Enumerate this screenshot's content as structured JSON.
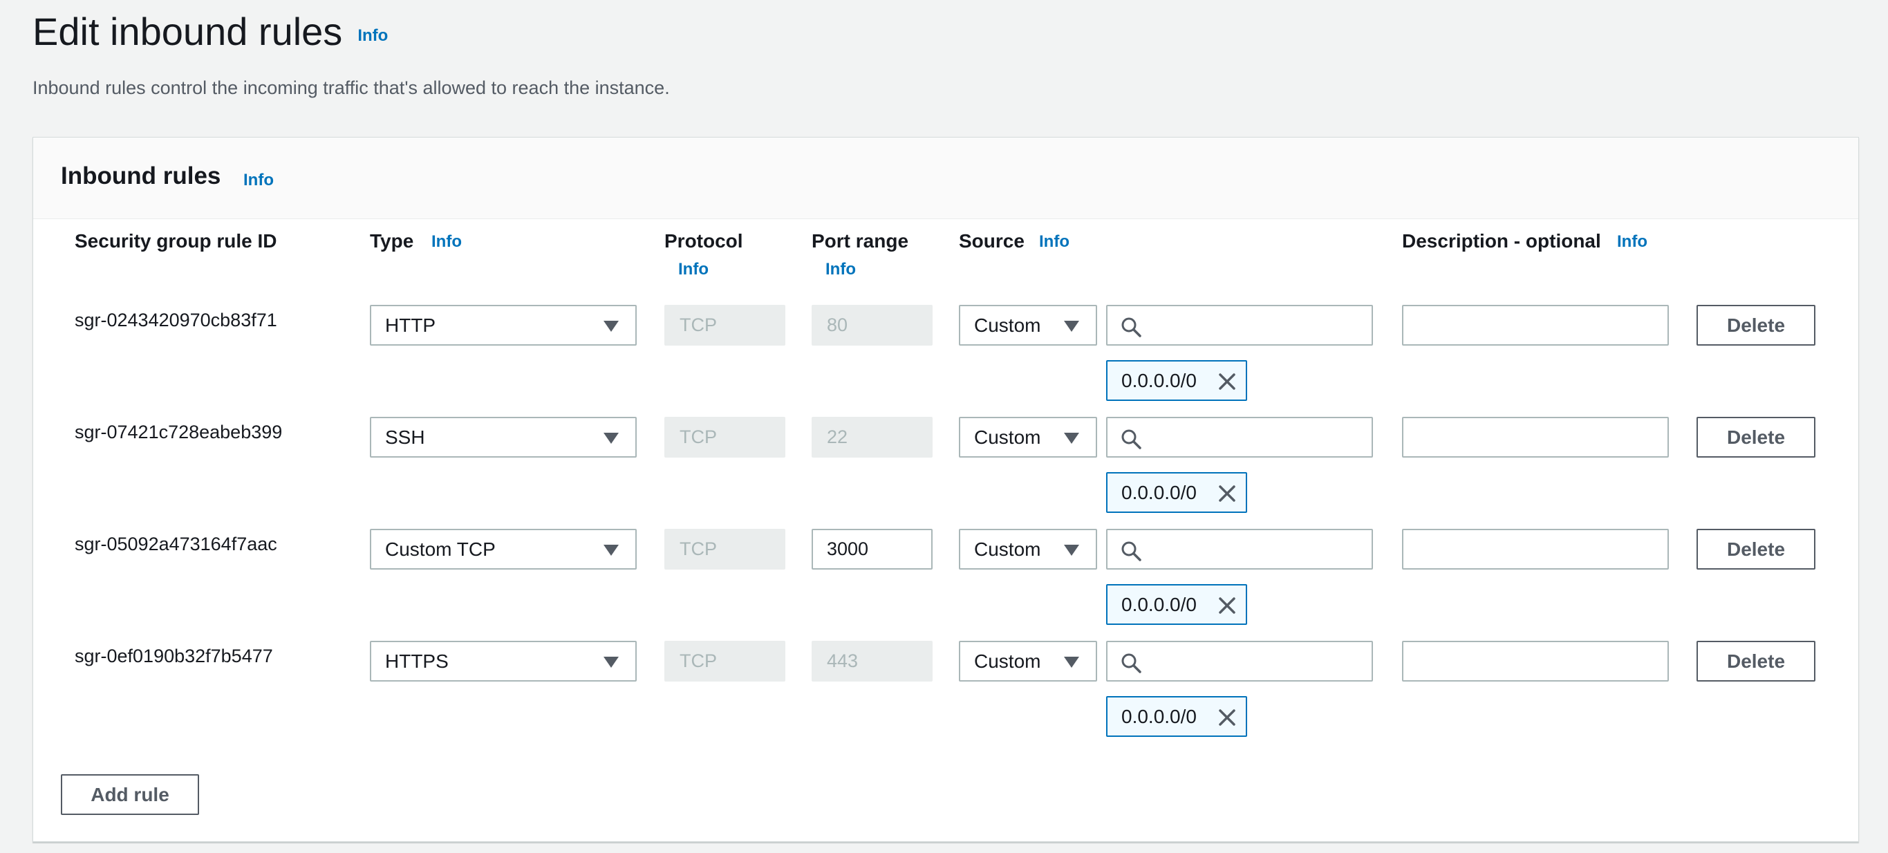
{
  "page": {
    "title": "Edit inbound rules",
    "info": "Info",
    "description": "Inbound rules control the incoming traffic that's allowed to reach the instance."
  },
  "panel": {
    "title": "Inbound rules",
    "info": "Info",
    "columns": {
      "rule_id": "Security group rule ID",
      "type": "Type",
      "protocol": "Protocol",
      "port_range": "Port range",
      "source": "Source",
      "description": "Description - optional",
      "info": "Info"
    },
    "rules": [
      {
        "id": "sgr-0243420970cb83f71",
        "type": "HTTP",
        "protocol": "TCP",
        "port": "80",
        "port_editable": false,
        "source_type": "Custom",
        "search_value": "",
        "cidr": "0.0.0.0/0",
        "description": "",
        "delete_label": "Delete"
      },
      {
        "id": "sgr-07421c728eabeb399",
        "type": "SSH",
        "protocol": "TCP",
        "port": "22",
        "port_editable": false,
        "source_type": "Custom",
        "search_value": "",
        "cidr": "0.0.0.0/0",
        "description": "",
        "delete_label": "Delete"
      },
      {
        "id": "sgr-05092a473164f7aac",
        "type": "Custom TCP",
        "protocol": "TCP",
        "port": "3000",
        "port_editable": true,
        "source_type": "Custom",
        "search_value": "",
        "cidr": "0.0.0.0/0",
        "description": "",
        "delete_label": "Delete"
      },
      {
        "id": "sgr-0ef0190b32f7b5477",
        "type": "HTTPS",
        "protocol": "TCP",
        "port": "443",
        "port_editable": false,
        "source_type": "Custom",
        "search_value": "",
        "cidr": "0.0.0.0/0",
        "description": "",
        "delete_label": "Delete"
      }
    ],
    "add_rule_label": "Add rule"
  },
  "colors": {
    "link": "#0073bb",
    "background": "#f2f3f3",
    "token_background": "#f1faff",
    "disabled_field": "#eaeded"
  },
  "icons": {
    "select": "caret-down-icon",
    "search": "search-icon",
    "remove_token": "close-icon"
  }
}
